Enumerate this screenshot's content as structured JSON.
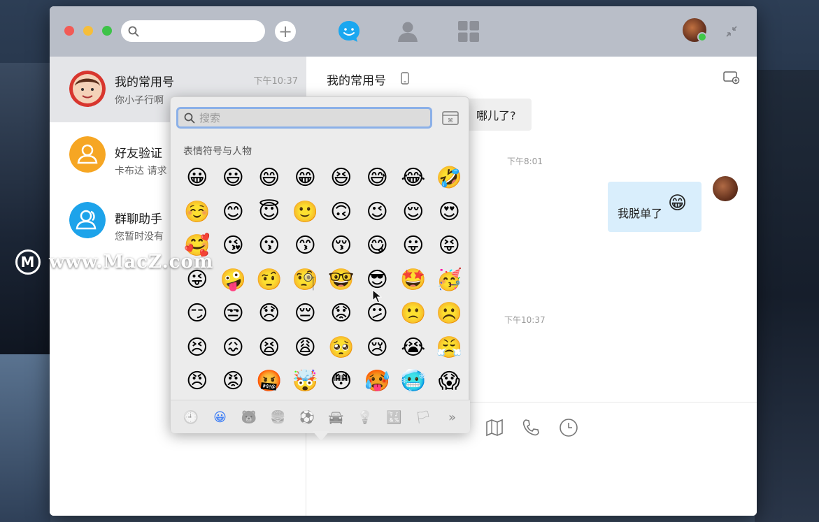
{
  "titlebar": {
    "search_placeholder": "",
    "add_label": "+"
  },
  "conversations": [
    {
      "name": "我的常用号",
      "preview": "你小子行啊",
      "time": "下午10:37"
    },
    {
      "name": "好友验证",
      "preview": "卡布达 请求"
    },
    {
      "name": "群聊助手",
      "preview": "您暂时没有"
    }
  ],
  "chat": {
    "title": "我的常用号",
    "bubble_left_text": "哪儿了?",
    "time_1": "下午8:01",
    "bubble_right_text": "我脱单了",
    "bubble_right_emoji": "😁",
    "time_2": "下午10:37"
  },
  "picker": {
    "search_placeholder": "搜索",
    "section_title": "表情符号与人物",
    "emojis": [
      "😀",
      "😃",
      "😄",
      "😁",
      "😆",
      "😅",
      "😂",
      "🤣",
      "☺️",
      "😊",
      "😇",
      "🙂",
      "🙃",
      "😉",
      "😌",
      "😍",
      "🥰",
      "😘",
      "😗",
      "😙",
      "😚",
      "😋",
      "😛",
      "😝",
      "😜",
      "🤪",
      "🤨",
      "🧐",
      "🤓",
      "😎",
      "🤩",
      "🥳",
      "😏",
      "😒",
      "😞",
      "😔",
      "😟",
      "😕",
      "🙁",
      "☹️",
      "😣",
      "😖",
      "😫",
      "😩",
      "🥺",
      "😢",
      "😭",
      "😤",
      "😠",
      "😡",
      "🤬",
      "🤯",
      "😳",
      "🥵",
      "🥶",
      "😱"
    ],
    "tabs": [
      "🕘",
      "😀",
      "🐻",
      "🍔",
      "⚽",
      "🚘",
      "💡",
      "🔣",
      "🏳",
      "»"
    ]
  },
  "watermark": {
    "logo": "M",
    "text": "www.MacZ.com"
  }
}
